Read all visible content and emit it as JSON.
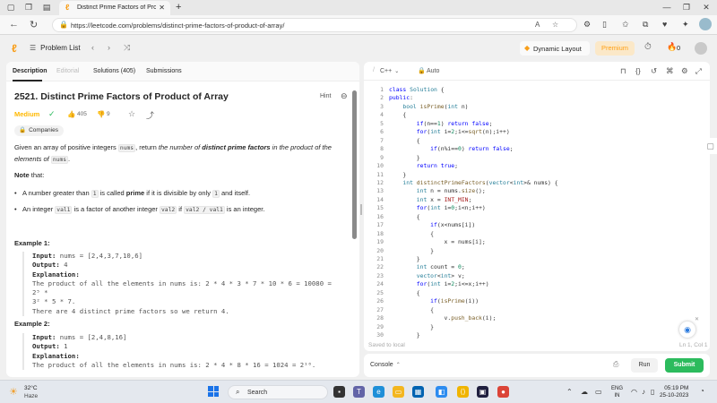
{
  "browser": {
    "tab_title": "Distinct Prime Factors of Product",
    "url": "https://leetcode.com/problems/distinct-prime-factors-of-product-of-array/"
  },
  "nav": {
    "problem_list": "Problem List",
    "dynamic_layout": "Dynamic Layout",
    "premium": "Premium",
    "streak": "0"
  },
  "tabs": {
    "description": "Description",
    "editorial": "Editorial",
    "solutions": "Solutions (405)",
    "submissions": "Submissions"
  },
  "problem": {
    "title": "2521. Distinct Prime Factors of Product of Array",
    "hint": "Hint",
    "difficulty": "Medium",
    "likes": "405",
    "dislikes": "9",
    "companies": "Companies",
    "p1": {
      "a": "Given an array of positive integers ",
      "code": "nums",
      "b": ", return ",
      "c": "the number of ",
      "d": "distinct prime factors",
      "e": " in the product of the elements of ",
      "code2": "nums",
      "f": "."
    },
    "note": "Note",
    "note_tail": " that:",
    "b1": {
      "a": "A number greater than ",
      "code": "1",
      "b": " is called ",
      "c": "prime",
      "d": " if it is divisible by only ",
      "code2": "1",
      "e": " and itself."
    },
    "b2": {
      "a": "An integer ",
      "code": "val1",
      "b": " is a factor of another integer ",
      "code2": "val2",
      "c": " if ",
      "code3": "val2 / val1",
      "d": " is an integer."
    }
  },
  "examples": [
    {
      "header": "Example 1:",
      "input_label": "Input:",
      "input": " nums = [2,4,3,7,10,6]",
      "output_label": "Output:",
      "output": " 4",
      "explanation_label": "Explanation:",
      "exp1": "The product of all the elements in nums is: 2 * 4 * 3 * 7 * 10 * 6 = 10080 = 2⁵ *",
      "exp2": "3² * 5 * 7.",
      "exp3": "There are 4 distinct prime factors so we return 4."
    },
    {
      "header": "Example 2:",
      "input_label": "Input:",
      "input": " nums = [2,4,8,16]",
      "output_label": "Output:",
      "output": " 1",
      "explanation_label": "Explanation:",
      "exp1": "The product of all the elements in nums is: 2 * 4 * 8 * 16 = 1024 = 2¹⁰."
    }
  ],
  "editor": {
    "language": "C++",
    "mode": "Auto",
    "saved": "Saved to local",
    "cursor": "Ln 1, Col 1"
  },
  "code_lines": [
    {
      "n": "1",
      "t": "class Solution {"
    },
    {
      "n": "2",
      "t": "public:"
    },
    {
      "n": "3",
      "t": "    bool isPrime(int n)"
    },
    {
      "n": "4",
      "t": "    {"
    },
    {
      "n": "5",
      "t": "        if(n==1) return false;"
    },
    {
      "n": "6",
      "t": "        for(int i=2;i<=sqrt(n);i++)"
    },
    {
      "n": "7",
      "t": "        {"
    },
    {
      "n": "8",
      "t": "            if(n%i==0) return false;"
    },
    {
      "n": "9",
      "t": "        }"
    },
    {
      "n": "10",
      "t": "        return true;"
    },
    {
      "n": "11",
      "t": "    }"
    },
    {
      "n": "12",
      "t": "    int distinctPrimeFactors(vector<int>& nums) {"
    },
    {
      "n": "13",
      "t": "        int n = nums.size();"
    },
    {
      "n": "14",
      "t": "        int x = INT_MIN;"
    },
    {
      "n": "15",
      "t": "        for(int i=0;i<n;i++)"
    },
    {
      "n": "16",
      "t": "        {"
    },
    {
      "n": "17",
      "t": "            if(x<nums[i])"
    },
    {
      "n": "18",
      "t": "            {"
    },
    {
      "n": "19",
      "t": "                x = nums[i];"
    },
    {
      "n": "20",
      "t": "            }"
    },
    {
      "n": "21",
      "t": "        }"
    },
    {
      "n": "22",
      "t": "        int count = 0;"
    },
    {
      "n": "23",
      "t": "        vector<int> v;"
    },
    {
      "n": "24",
      "t": "        for(int i=2;i<=x;i++)"
    },
    {
      "n": "25",
      "t": "        {"
    },
    {
      "n": "26",
      "t": "            if(isPrime(i))"
    },
    {
      "n": "27",
      "t": "            {"
    },
    {
      "n": "28",
      "t": "                v.push_back(i);"
    },
    {
      "n": "29",
      "t": "            }"
    },
    {
      "n": "30",
      "t": "        }"
    }
  ],
  "console": {
    "label": "Console",
    "run": "Run",
    "submit": "Submit"
  },
  "taskbar": {
    "temp": "32°C",
    "condition": "Haze",
    "search": "Search",
    "lang1": "ENG",
    "lang2": "IN",
    "time": "05:19 PM",
    "date": "25-10-2023"
  },
  "colors": {
    "accent": "#ffa116",
    "medium": "#ffb800",
    "submit": "#2cbb5d"
  }
}
